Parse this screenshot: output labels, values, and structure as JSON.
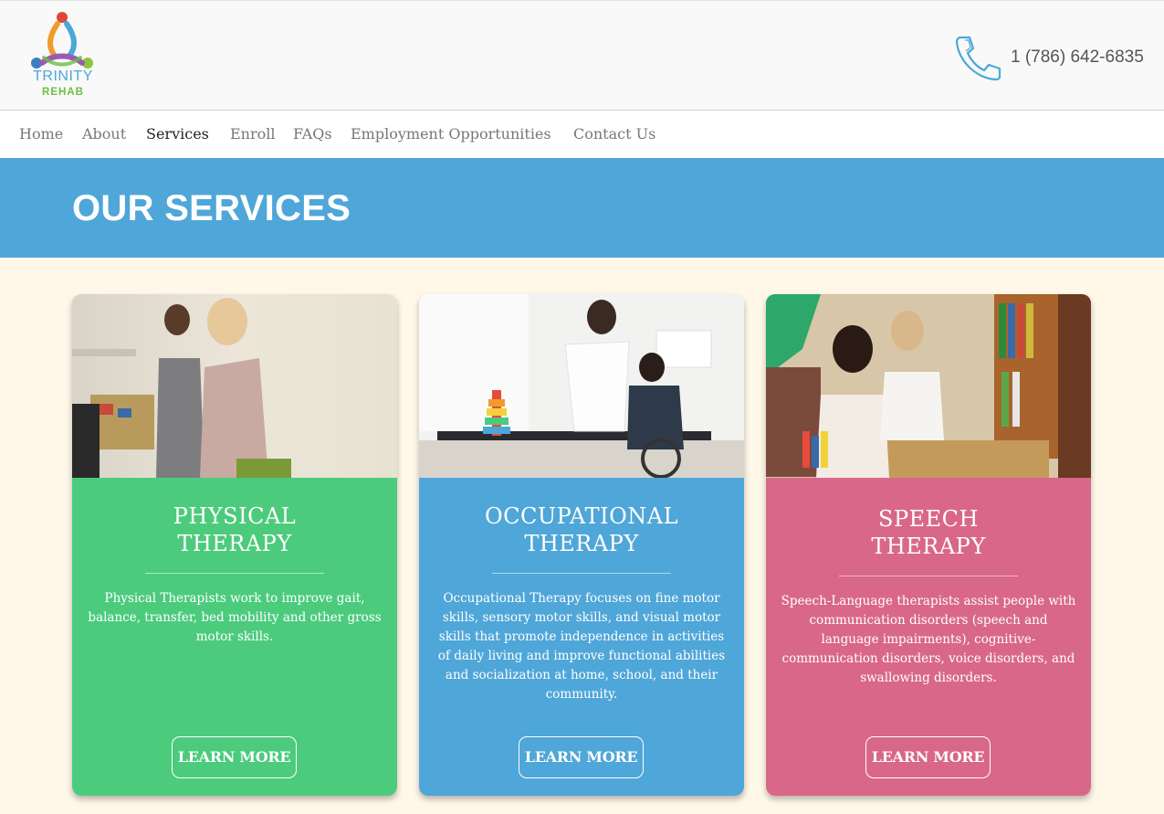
{
  "logo": {
    "line1": "TRINITY",
    "line2": "REHAB",
    "icon": "trinity-logo-icon"
  },
  "contact": {
    "phone": "1 (786) 642-6835",
    "icon": "phone-icon"
  },
  "nav": {
    "items": [
      {
        "label": "Home"
      },
      {
        "label": "About"
      },
      {
        "label": "Services",
        "active": true
      },
      {
        "label": "Enroll"
      },
      {
        "label": "FAQs"
      },
      {
        "label": "Employment Opportunities"
      },
      {
        "label": "Contact Us"
      }
    ]
  },
  "banner": {
    "title": "OUR SERVICES"
  },
  "cards": [
    {
      "title_line1": "PHYSICAL",
      "title_line2": "THERAPY",
      "text": "Physical Therapists work to improve gait, balance, transfer, bed mobility and other gross motor skills.",
      "button": "LEARN MORE",
      "color": "#4ccb7d"
    },
    {
      "title_line1": "OCCUPATIONAL",
      "title_line2": "THERAPY",
      "text": "Occupational Therapy focuses on fine motor skills, sensory motor skills, and visual motor skills that promote independence in activities of daily living and improve functional abilities and socialization at home, school, and their community.",
      "button": "LEARN MORE",
      "color": "#4fa6d8"
    },
    {
      "title_line1": "SPEECH",
      "title_line2": "THERAPY",
      "text": "Speech-Language therapists assist people with communication disorders (speech and language impairments), cognitive-communication disorders, voice disorders, and swallowing disorders.",
      "button": "LEARN MORE",
      "color": "#d9678a"
    }
  ],
  "colors": {
    "banner": "#4fa6d8",
    "page_bg": "#fff8e9"
  }
}
